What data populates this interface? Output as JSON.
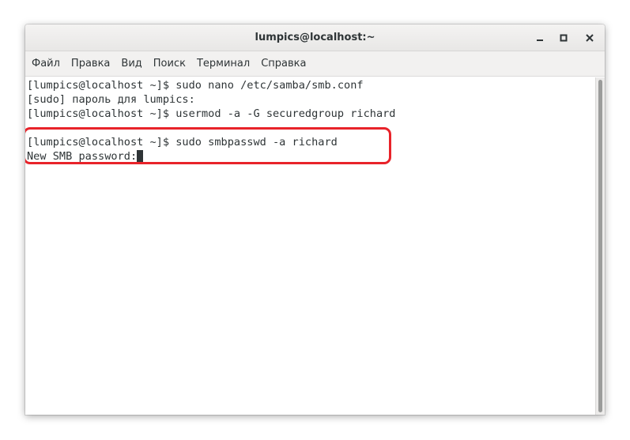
{
  "window": {
    "title": "lumpics@localhost:~"
  },
  "menu": [
    {
      "label": "Файл"
    },
    {
      "label": "Правка"
    },
    {
      "label": "Вид"
    },
    {
      "label": "Поиск"
    },
    {
      "label": "Терминал"
    },
    {
      "label": "Справка"
    }
  ],
  "terminal": {
    "lines": [
      "[lumpics@localhost ~]$ sudo nano /etc/samba/smb.conf",
      "[sudo] пароль для lumpics:",
      "[lumpics@localhost ~]$ usermod -a -G securedgroup richard",
      "",
      "[lumpics@localhost ~]$ sudo smbpasswd -a richard",
      "New SMB password:"
    ]
  },
  "icons": {
    "minimize": "minimize-icon",
    "maximize": "maximize-icon",
    "close": "close-icon"
  },
  "colors": {
    "highlight": "#e8232a",
    "text": "#2e3436",
    "background": "#ffffff"
  }
}
